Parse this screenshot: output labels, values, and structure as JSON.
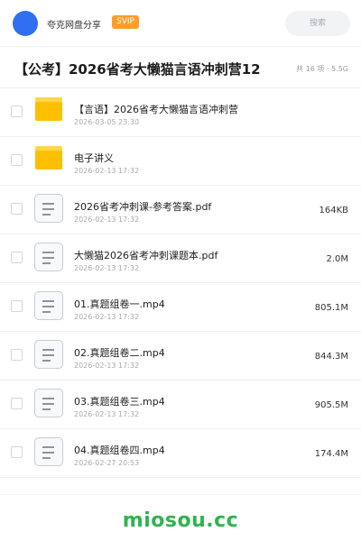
{
  "header": {
    "brand": "夸克网盘分享",
    "badge": "SVIP",
    "search_placeholder": "搜索"
  },
  "title": {
    "text": "【公考】2026省考大懒猫言语冲刺营12",
    "meta": "共 16 项 · 5.5G"
  },
  "files": [
    {
      "icon": "folder-icon",
      "name": "【言语】2026省考大懒猫言语冲刺营",
      "date": "2026-03-05 23:30",
      "size": ""
    },
    {
      "icon": "folder-icon",
      "name": "电子讲义",
      "date": "2026-02-13 17:32",
      "size": ""
    },
    {
      "icon": "document-icon",
      "name": "2026省考冲刺课-参考答案.pdf",
      "date": "2026-02-13 17:32",
      "size": "164KB"
    },
    {
      "icon": "document-icon",
      "name": "大懒猫2026省考冲刺课题本.pdf",
      "date": "2026-02-13 17:32",
      "size": "2.0M"
    },
    {
      "icon": "document-icon",
      "name": "01.真题组卷一.mp4",
      "date": "2026-02-13 17:32",
      "size": "805.1M"
    },
    {
      "icon": "document-icon",
      "name": "02.真题组卷二.mp4",
      "date": "2026-02-13 17:32",
      "size": "844.3M"
    },
    {
      "icon": "document-icon",
      "name": "03.真题组卷三.mp4",
      "date": "2026-02-13 17:32",
      "size": "905.5M"
    },
    {
      "icon": "document-icon",
      "name": "04.真题组卷四.mp4",
      "date": "2026-02-27 20:53",
      "size": "174.4M"
    }
  ],
  "watermark": "miosou.cc",
  "colors": {
    "avatar": "#2f6ff2",
    "badge": "#ff9c2a",
    "folder": "#fdc000",
    "watermark": "#2fb350"
  }
}
